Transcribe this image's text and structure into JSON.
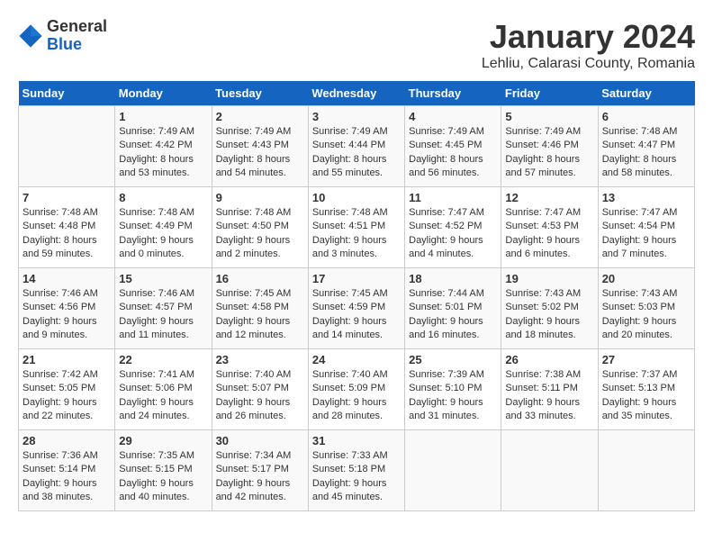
{
  "header": {
    "logo_general": "General",
    "logo_blue": "Blue",
    "title": "January 2024",
    "location": "Lehliu, Calarasi County, Romania"
  },
  "calendar": {
    "days_of_week": [
      "Sunday",
      "Monday",
      "Tuesday",
      "Wednesday",
      "Thursday",
      "Friday",
      "Saturday"
    ],
    "weeks": [
      [
        {
          "day": "",
          "info": ""
        },
        {
          "day": "1",
          "info": "Sunrise: 7:49 AM\nSunset: 4:42 PM\nDaylight: 8 hours\nand 53 minutes."
        },
        {
          "day": "2",
          "info": "Sunrise: 7:49 AM\nSunset: 4:43 PM\nDaylight: 8 hours\nand 54 minutes."
        },
        {
          "day": "3",
          "info": "Sunrise: 7:49 AM\nSunset: 4:44 PM\nDaylight: 8 hours\nand 55 minutes."
        },
        {
          "day": "4",
          "info": "Sunrise: 7:49 AM\nSunset: 4:45 PM\nDaylight: 8 hours\nand 56 minutes."
        },
        {
          "day": "5",
          "info": "Sunrise: 7:49 AM\nSunset: 4:46 PM\nDaylight: 8 hours\nand 57 minutes."
        },
        {
          "day": "6",
          "info": "Sunrise: 7:48 AM\nSunset: 4:47 PM\nDaylight: 8 hours\nand 58 minutes."
        }
      ],
      [
        {
          "day": "7",
          "info": "Sunrise: 7:48 AM\nSunset: 4:48 PM\nDaylight: 8 hours\nand 59 minutes."
        },
        {
          "day": "8",
          "info": "Sunrise: 7:48 AM\nSunset: 4:49 PM\nDaylight: 9 hours\nand 0 minutes."
        },
        {
          "day": "9",
          "info": "Sunrise: 7:48 AM\nSunset: 4:50 PM\nDaylight: 9 hours\nand 2 minutes."
        },
        {
          "day": "10",
          "info": "Sunrise: 7:48 AM\nSunset: 4:51 PM\nDaylight: 9 hours\nand 3 minutes."
        },
        {
          "day": "11",
          "info": "Sunrise: 7:47 AM\nSunset: 4:52 PM\nDaylight: 9 hours\nand 4 minutes."
        },
        {
          "day": "12",
          "info": "Sunrise: 7:47 AM\nSunset: 4:53 PM\nDaylight: 9 hours\nand 6 minutes."
        },
        {
          "day": "13",
          "info": "Sunrise: 7:47 AM\nSunset: 4:54 PM\nDaylight: 9 hours\nand 7 minutes."
        }
      ],
      [
        {
          "day": "14",
          "info": "Sunrise: 7:46 AM\nSunset: 4:56 PM\nDaylight: 9 hours\nand 9 minutes."
        },
        {
          "day": "15",
          "info": "Sunrise: 7:46 AM\nSunset: 4:57 PM\nDaylight: 9 hours\nand 11 minutes."
        },
        {
          "day": "16",
          "info": "Sunrise: 7:45 AM\nSunset: 4:58 PM\nDaylight: 9 hours\nand 12 minutes."
        },
        {
          "day": "17",
          "info": "Sunrise: 7:45 AM\nSunset: 4:59 PM\nDaylight: 9 hours\nand 14 minutes."
        },
        {
          "day": "18",
          "info": "Sunrise: 7:44 AM\nSunset: 5:01 PM\nDaylight: 9 hours\nand 16 minutes."
        },
        {
          "day": "19",
          "info": "Sunrise: 7:43 AM\nSunset: 5:02 PM\nDaylight: 9 hours\nand 18 minutes."
        },
        {
          "day": "20",
          "info": "Sunrise: 7:43 AM\nSunset: 5:03 PM\nDaylight: 9 hours\nand 20 minutes."
        }
      ],
      [
        {
          "day": "21",
          "info": "Sunrise: 7:42 AM\nSunset: 5:05 PM\nDaylight: 9 hours\nand 22 minutes."
        },
        {
          "day": "22",
          "info": "Sunrise: 7:41 AM\nSunset: 5:06 PM\nDaylight: 9 hours\nand 24 minutes."
        },
        {
          "day": "23",
          "info": "Sunrise: 7:40 AM\nSunset: 5:07 PM\nDaylight: 9 hours\nand 26 minutes."
        },
        {
          "day": "24",
          "info": "Sunrise: 7:40 AM\nSunset: 5:09 PM\nDaylight: 9 hours\nand 28 minutes."
        },
        {
          "day": "25",
          "info": "Sunrise: 7:39 AM\nSunset: 5:10 PM\nDaylight: 9 hours\nand 31 minutes."
        },
        {
          "day": "26",
          "info": "Sunrise: 7:38 AM\nSunset: 5:11 PM\nDaylight: 9 hours\nand 33 minutes."
        },
        {
          "day": "27",
          "info": "Sunrise: 7:37 AM\nSunset: 5:13 PM\nDaylight: 9 hours\nand 35 minutes."
        }
      ],
      [
        {
          "day": "28",
          "info": "Sunrise: 7:36 AM\nSunset: 5:14 PM\nDaylight: 9 hours\nand 38 minutes."
        },
        {
          "day": "29",
          "info": "Sunrise: 7:35 AM\nSunset: 5:15 PM\nDaylight: 9 hours\nand 40 minutes."
        },
        {
          "day": "30",
          "info": "Sunrise: 7:34 AM\nSunset: 5:17 PM\nDaylight: 9 hours\nand 42 minutes."
        },
        {
          "day": "31",
          "info": "Sunrise: 7:33 AM\nSunset: 5:18 PM\nDaylight: 9 hours\nand 45 minutes."
        },
        {
          "day": "",
          "info": ""
        },
        {
          "day": "",
          "info": ""
        },
        {
          "day": "",
          "info": ""
        }
      ]
    ]
  }
}
